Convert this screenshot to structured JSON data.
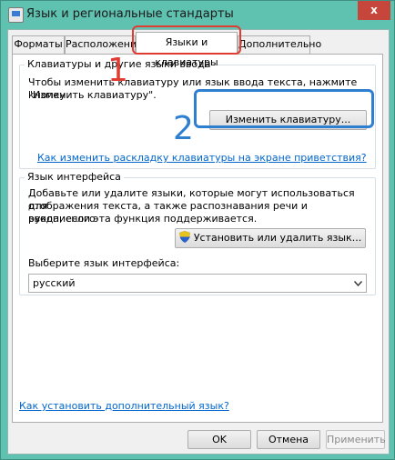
{
  "window": {
    "title": "Язык и региональные стандарты",
    "close_glyph": "x"
  },
  "tabs": [
    {
      "label": "Форматы",
      "active": false
    },
    {
      "label": "Расположение",
      "active": false
    },
    {
      "label": "Языки и клавиатуры",
      "active": true
    },
    {
      "label": "Дополнительно",
      "active": false
    }
  ],
  "keyboards_group": {
    "legend": "Клавиатуры и другие языки ввода",
    "description_line1": "Чтобы изменить клавиатуру или язык ввода текста, нажмите кнопку",
    "description_line2": "\"Изменить клавиатуру\".",
    "change_button": "Изменить клавиатуру...",
    "welcome_link": "Как изменить раскладку клавиатуры на экране приветствия?"
  },
  "interface_group": {
    "legend": "Язык интерфейса",
    "description_line1": "Добавьте или удалите языки, которые могут использоваться для",
    "description_line2": "отображения текста, а также распознавания речи и рукописного",
    "description_line3": "ввода, если эта функция поддерживается.",
    "install_button": "Установить или удалить язык...",
    "select_label": "Выберите язык интерфейса:",
    "select_value": "русский"
  },
  "bottom_link": "Как установить дополнительный язык?",
  "buttons": {
    "ok": "OK",
    "cancel": "Отмена",
    "apply": "Применить"
  },
  "annotations": {
    "marker1": "1",
    "marker2": "2",
    "marker1_color": "#e03c32",
    "marker2_color": "#2f7fd1"
  }
}
